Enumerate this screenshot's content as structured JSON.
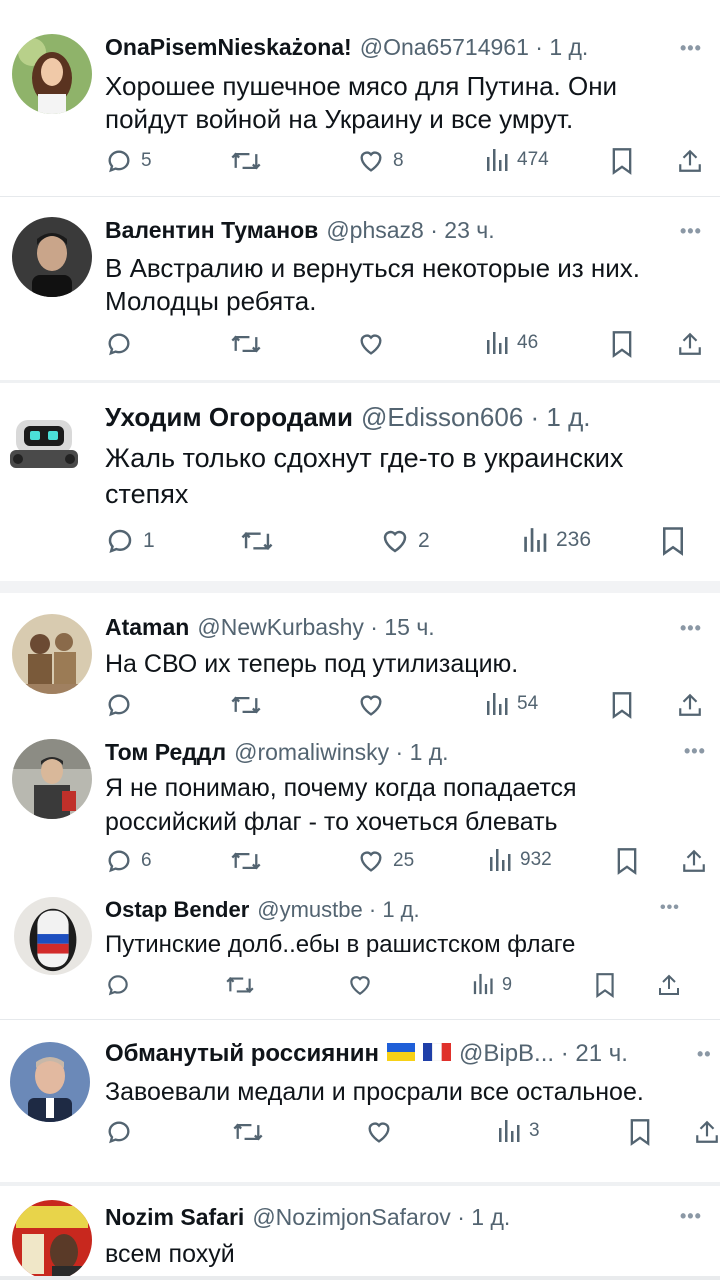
{
  "tweets": [
    {
      "name": "OnaPisemNieskażona!",
      "handle": "@Ona65714961",
      "time": "1 д.",
      "text_lines": [
        "Хорошее пушечное мясо для Путина. Они",
        "пойдут войной на Украину и все умрут."
      ],
      "replies": "5",
      "likes": "8",
      "views": "474"
    },
    {
      "name": "Валентин Туманов",
      "handle": "@phsaz8",
      "time": "23 ч.",
      "text_lines": [
        "В Австралию и вернуться некоторые из них.",
        "Молодцы ребята."
      ],
      "views": "46"
    },
    {
      "name": "Уходим Огородами",
      "handle": "@Edisson606",
      "time": "1 д.",
      "text_lines": [
        "Жаль только сдохнут где-то в украинских",
        "степях"
      ],
      "replies": "1",
      "likes": "2",
      "views": "236"
    },
    {
      "name": "Ataman",
      "handle": "@NewKurbashy",
      "time": "15 ч.",
      "text_lines": [
        "На СВО их теперь под утилизацию."
      ],
      "views": "54"
    },
    {
      "name": "Том Реддл",
      "handle": "@romaliwinsky",
      "time": "1 д.",
      "text_lines": [
        "Я не понимаю, почему когда попадается",
        "российский флаг - то хочеться блевать"
      ],
      "replies": "6",
      "likes": "25",
      "views": "932"
    },
    {
      "name": "Ostap Bender",
      "handle": "@ymustbe",
      "time": "1 д.",
      "text_lines": [
        "Путинские долб..ебы в рашистском флаге"
      ],
      "views": "9"
    },
    {
      "name": "Обманутый россиянин",
      "handle": "@BipB...",
      "time": "21 ч.",
      "text_lines": [
        "Завоевали медали и просрали все остальное."
      ],
      "views": "3"
    },
    {
      "name": "Nozim Safari",
      "handle": "@NozimjonSafarov",
      "time": "1 д.",
      "text_lines": [
        "всем похуй"
      ]
    }
  ],
  "colors": {
    "text": "#0f1419",
    "secondary": "#536471",
    "divider": "#e6e9ec",
    "flag_blue": "#1f5fd8",
    "flag_yellow": "#f7d117",
    "flag_red": "#e0312b"
  },
  "icons": [
    "reply-icon",
    "retweet-icon",
    "like-icon",
    "views-icon",
    "bookmark-icon",
    "share-icon",
    "more-icon"
  ]
}
